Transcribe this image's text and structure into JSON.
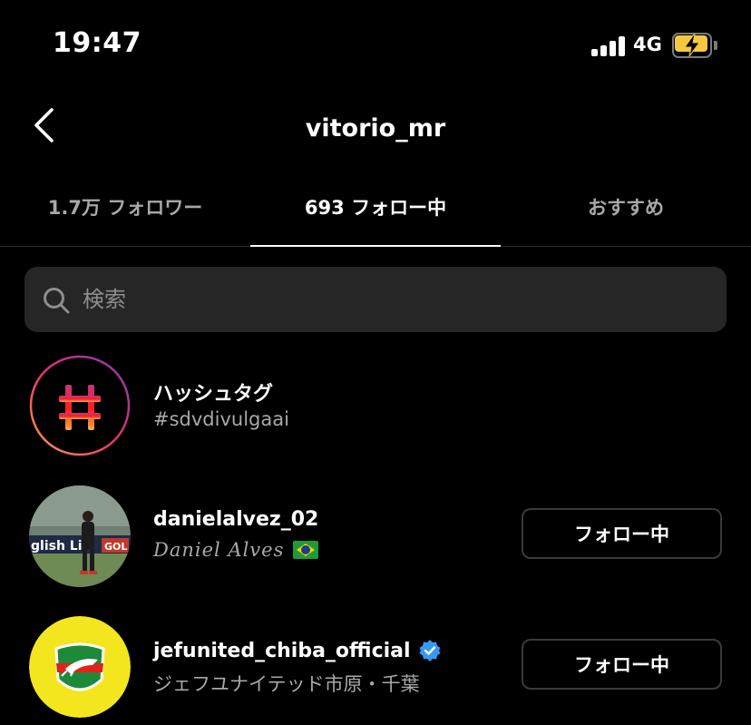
{
  "status_bar": {
    "time": "19:47",
    "network": "4G",
    "battery_color": "#f5c842"
  },
  "header": {
    "back_icon": "chevron-left-icon",
    "title": "vitorio_mr"
  },
  "tabs": [
    {
      "label": "1.7万 フォロワー",
      "active": false
    },
    {
      "label": "693 フォロー中",
      "active": true
    },
    {
      "label": "おすすめ",
      "active": false
    }
  ],
  "search": {
    "placeholder": "検索",
    "value": ""
  },
  "list": [
    {
      "name": "ハッシュタグ",
      "subtitle": "#sdvdivulgaai",
      "avatar_icon": "hashtag-icon"
    },
    {
      "name": "danielalvez_02",
      "subtitle": "Daniel Alves",
      "flag_icon": "brazil-flag-icon",
      "button_label": "フォロー中"
    },
    {
      "name": "jefunited_chiba_official",
      "verified_icon": "verified-badge-icon",
      "subtitle": "ジェフユナイテッド市原・千葉",
      "button_label": "フォロー中"
    }
  ],
  "colors": {
    "background": "#000000",
    "search_bg": "#262626",
    "muted_text": "#a8a8a8",
    "verified": "#3897f0",
    "battery": "#f5c842"
  }
}
